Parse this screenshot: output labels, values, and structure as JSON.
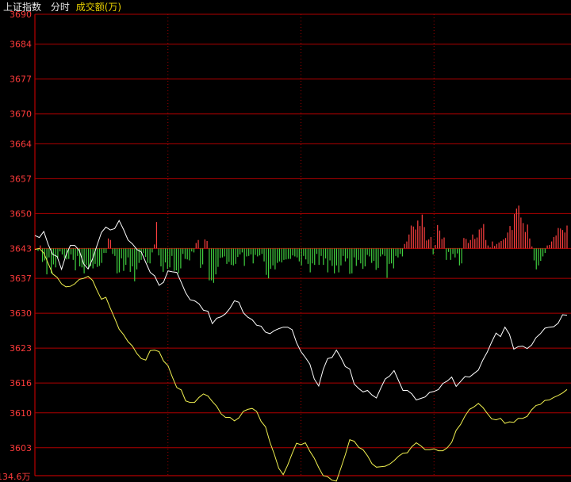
{
  "header": {
    "index_name": "上证指数",
    "mode": "分时",
    "indicator": "成交额(万)"
  },
  "colors": {
    "background": "#000000",
    "grid": "#b00000",
    "vgrid": "#a00000",
    "axis": "#e00000",
    "tick_text": "#ff3b3b",
    "header_text": "#e8e8e8",
    "indicator_text": "#e8d000",
    "price_line": "#ffffff",
    "avg_line": "#f0f050",
    "up_bar": "#ff4040",
    "down_bar": "#40d040"
  },
  "chart_data": {
    "type": "line",
    "title": "上证指数 分时",
    "xlabel": "",
    "ylabel": "",
    "ylim": [
      3597.4,
      3690
    ],
    "y_ticks": [
      "3690",
      "3684",
      "3677",
      "3670",
      "3664",
      "3657",
      "3650",
      "3643",
      "3637",
      "3630",
      "3623",
      "3616",
      "3610",
      "3603"
    ],
    "y_tick_values": [
      3690,
      3684,
      3677,
      3670,
      3664,
      3657,
      3650,
      3643,
      3637,
      3630,
      3623,
      3616,
      3610,
      3603
    ],
    "baseline": 3643,
    "volume_label": "134.6万",
    "x": [
      0,
      2,
      4,
      6,
      8,
      10,
      12,
      14,
      16,
      18,
      20,
      22,
      24,
      26,
      28,
      30,
      32,
      34,
      36,
      38,
      40,
      42,
      44,
      46,
      48,
      50,
      52,
      54,
      56,
      58,
      60,
      62,
      64,
      66,
      68,
      70,
      72,
      74,
      76,
      78,
      80,
      82,
      84,
      86,
      88,
      90,
      92,
      94,
      96,
      98,
      100,
      102,
      104,
      106,
      108,
      110,
      112,
      114,
      116,
      118,
      120,
      122,
      124,
      126,
      128,
      130,
      132,
      134,
      136,
      138,
      140,
      142,
      144,
      146,
      148,
      150,
      152,
      154,
      156,
      158,
      160,
      162,
      164,
      166,
      168,
      170,
      172,
      174,
      176,
      178,
      180,
      182,
      184,
      186,
      188,
      190,
      192,
      194,
      196,
      198,
      200,
      202,
      204,
      206,
      208,
      210,
      212,
      214,
      216,
      218,
      220,
      222,
      224,
      226,
      228,
      230,
      232,
      234,
      236,
      238,
      240
    ],
    "series": [
      {
        "values": [
          3645.6,
          3645.2,
          3646.4,
          3643.8,
          3641.8,
          3641.4,
          3638.8,
          3641.6,
          3643.6,
          3643.6,
          3642.6,
          3639.9,
          3638.9,
          3640.9,
          3643.6,
          3646.2,
          3647.3,
          3646.7,
          3647.0,
          3648.6,
          3646.8,
          3644.7,
          3643.9,
          3642.8,
          3642.3,
          3640.2,
          3638.2,
          3637.5,
          3635.6,
          3636.2,
          3638.5,
          3638.3,
          3638.2,
          3636.2,
          3634.1,
          3632.7,
          3632.5,
          3631.9,
          3630.6,
          3630.4,
          3627.9,
          3629.0,
          3629.3,
          3629.9,
          3631.0,
          3632.5,
          3632.2,
          3630.1,
          3629.2,
          3628.7,
          3627.6,
          3627.4,
          3626.2,
          3625.9,
          3626.5,
          3626.9,
          3627.2,
          3627.2,
          3626.7,
          3624.1,
          3622.3,
          3621.1,
          3619.8,
          3616.8,
          3615.4,
          3618.7,
          3620.9,
          3621.1,
          3622.6,
          3621.1,
          3619.3,
          3618.8,
          3615.8,
          3614.9,
          3614.2,
          3614.5,
          3613.6,
          3613.0,
          3615.0,
          3616.8,
          3617.4,
          3618.5,
          3616.5,
          3614.5,
          3614.5,
          3613.8,
          3612.6,
          3612.9,
          3613.2,
          3614.1,
          3614.3,
          3614.7,
          3615.9,
          3616.4,
          3617.2,
          3615.3,
          3616.3,
          3617.3,
          3617.2,
          3617.9,
          3618.6,
          3620.6,
          3622.2,
          3624.2,
          3626.0,
          3625.3,
          3627.2,
          3625.8,
          3622.8,
          3623.3,
          3623.4,
          3622.9,
          3623.6,
          3625.1,
          3625.9,
          3627.0,
          3627.2,
          3627.3,
          3628.0,
          3629.7,
          3629.6
        ]
      },
      {
        "values": [
          3642.8,
          3643.0,
          3642.1,
          3640.0,
          3637.9,
          3637.2,
          3635.9,
          3635.3,
          3635.4,
          3635.9,
          3636.8,
          3637.0,
          3637.4,
          3636.6,
          3634.6,
          3632.8,
          3633.2,
          3631.0,
          3629.0,
          3626.8,
          3625.7,
          3624.3,
          3623.4,
          3621.9,
          3620.9,
          3620.6,
          3622.5,
          3622.6,
          3622.3,
          3620.4,
          3619.5,
          3617.2,
          3615.1,
          3614.6,
          3612.4,
          3612.1,
          3612.1,
          3613.1,
          3613.8,
          3613.4,
          3612.3,
          3611.3,
          3609.8,
          3609.1,
          3609.1,
          3608.4,
          3609.0,
          3610.3,
          3610.7,
          3610.9,
          3610.3,
          3608.3,
          3607.2,
          3604.1,
          3601.7,
          3598.9,
          3597.6,
          3599.5,
          3601.8,
          3603.9,
          3603.6,
          3604.0,
          3602.3,
          3600.9,
          3599.0,
          3597.4,
          3597.2,
          3596.5,
          3596.3,
          3598.9,
          3601.6,
          3604.6,
          3604.3,
          3603.1,
          3602.6,
          3601.4,
          3599.8,
          3599.1,
          3599.2,
          3599.3,
          3599.7,
          3600.4,
          3601.3,
          3601.9,
          3602.0,
          3603.2,
          3604.0,
          3603.4,
          3602.6,
          3602.6,
          3602.8,
          3602.4,
          3602.4,
          3603.0,
          3604.1,
          3606.5,
          3607.7,
          3609.4,
          3610.7,
          3611.2,
          3611.9,
          3611.1,
          3609.9,
          3608.8,
          3608.6,
          3608.9,
          3607.9,
          3608.2,
          3608.1,
          3608.9,
          3608.9,
          3609.3,
          3610.6,
          3611.5,
          3611.7,
          3612.5,
          3612.6,
          3613.1,
          3613.5,
          3614.0,
          3614.7
        ]
      }
    ],
    "volume_bars": [
      -0.5,
      0.6,
      -2.7,
      -2.4,
      -5.2,
      -1.8,
      -5.0,
      -3.2,
      -3.8,
      -1.9,
      -0.6,
      -1.2,
      -1.9,
      -2.2,
      -2.1,
      -1.2,
      -2.3,
      -4.4,
      -1.5,
      -3.6,
      -3.8,
      -5.0,
      -3.3,
      -4.1,
      -3.6,
      -4.0,
      -3.1,
      -3.7,
      -3.5,
      -2.9,
      -0.9,
      -0.9,
      2.0,
      1.7,
      -1.1,
      -1.5,
      -5.0,
      -4.8,
      -2.0,
      -4.5,
      -3.3,
      -1.8,
      -4.7,
      -3.6,
      -6.6,
      -4.2,
      -2.9,
      -2.3,
      -0.9,
      -1.7,
      -2.9,
      -3.0,
      -0.8,
      0.8,
      5.3,
      -1.4,
      -3.6,
      -4.7,
      -2.8,
      -4.1,
      -3.8,
      -1.5,
      -4.5,
      -4.4,
      -5.0,
      -4.0,
      -1.1,
      -2.1,
      -2.2,
      -2.4,
      -0.6,
      -0.8,
      1.1,
      1.7,
      -3.9,
      -3.2,
      1.8,
      1.5,
      -6.4,
      -6.4,
      -6.9,
      -5.2,
      -3.7,
      -1.9,
      -1.8,
      -1.6,
      -3.1,
      -2.7,
      -3.3,
      -3.4,
      -3.1,
      -1.7,
      -1.2,
      -0.8,
      -3.5,
      -1.6,
      -1.5,
      -1.2,
      -3.0,
      -1.3,
      -1.6,
      -1.4,
      -1.1,
      -2.6,
      -5.3,
      -6.0,
      -4.1,
      -3.4,
      -4.2,
      -2.9,
      -2.6,
      -2.8,
      -2.3,
      -2.2,
      -2.1,
      -2.1,
      -1.4,
      -1.6,
      -1.8,
      -2.6,
      -3.4,
      -1.5,
      -2.2,
      -3.1,
      -4.8,
      -3.0,
      -3.3,
      -1.1,
      -3.3,
      -1.5,
      -3.3,
      -2.0,
      -4.8,
      -2.4,
      -3.5,
      -5.0,
      -3.4,
      -4.8,
      -3.4,
      -1.5,
      -2.6,
      -2.0,
      -5.1,
      -5.0,
      -1.8,
      -3.5,
      -2.3,
      -3.0,
      -4.1,
      -3.6,
      -1.3,
      -1.6,
      -2.9,
      -2.5,
      -4.3,
      -3.9,
      -1.6,
      -1.2,
      -1.5,
      -5.9,
      -3.1,
      -3.0,
      -4.0,
      -1.5,
      -1.8,
      -1.1,
      -1.6,
      0.9,
      1.4,
      2.8,
      4.6,
      4.4,
      3.8,
      5.6,
      4.5,
      6.8,
      4.3,
      1.6,
      1.8,
      2.3,
      -1.2,
      0.7,
      4.7,
      3.6,
      1.9,
      2.2,
      -2.3,
      -0.7,
      -2.3,
      -1.1,
      -1.8,
      -1.0,
      -3.4,
      -3.0,
      2.1,
      1.9,
      1.1,
      1.7,
      2.8,
      1.9,
      2.2,
      3.8,
      4.1,
      4.9,
      1.7,
      0.6,
      0.2,
      1.4,
      0.5,
      0.9,
      1.2,
      1.5,
      1.8,
      2.1,
      3.2,
      4.5,
      3.7,
      6.9,
      8.0,
      8.6,
      6.2,
      5.1,
      3.3,
      4.8,
      2.0,
      0.4,
      -2.4,
      -4.2,
      -3.4,
      -2.5,
      -1.6,
      -0.9,
      0.6,
      0.7,
      1.4,
      2.3,
      2.6,
      4.1,
      4.0,
      3.7,
      3.2,
      4.6
    ]
  }
}
